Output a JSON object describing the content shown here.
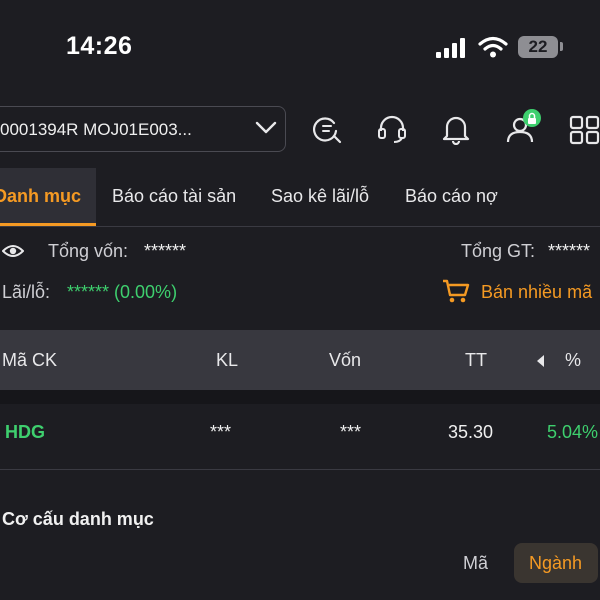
{
  "status_bar": {
    "time": "14:26",
    "battery": "22"
  },
  "account": {
    "value": "0001394R MOJ01E003..."
  },
  "tabs": [
    {
      "label": "Danh mục"
    },
    {
      "label": "Báo cáo tài sản"
    },
    {
      "label": "Sao kê lãi/lỗ"
    },
    {
      "label": "Báo cáo nợ"
    }
  ],
  "summary": {
    "total_capital_label": "Tổng vốn:",
    "total_capital_value": "******",
    "total_value_label": "Tổng GT:",
    "total_value_value": "******",
    "pl_label": "Lãi/lỗ:",
    "pl_value": "****** (0.00%)",
    "sell_many_label": "Bán nhiều mã"
  },
  "table": {
    "headers": {
      "symbol": "Mã CK",
      "volume": "KL",
      "capital": "Vốn",
      "price": "TT",
      "percent": "%"
    },
    "rows": [
      {
        "symbol": "HDG",
        "volume": "***",
        "capital": "***",
        "price": "35.30",
        "percent": "5.04%"
      }
    ]
  },
  "structure": {
    "title": "Cơ cấu danh mục",
    "toggle": [
      "Mã",
      "Ngành"
    ],
    "selected": "Ngành"
  },
  "colors": {
    "accent": "#f59a23",
    "positive": "#3ecf6e",
    "background": "#1d1d22"
  }
}
